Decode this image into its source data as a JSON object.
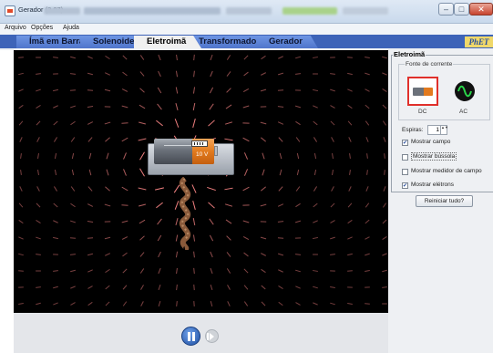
{
  "window": {
    "title": "Gerador (2.07)",
    "minimize": "–",
    "maximize": "□",
    "close": "✕"
  },
  "menu": [
    "Arquivo",
    "Opções",
    "Ajuda"
  ],
  "tabs": [
    {
      "label": "Ímã em Barra",
      "selected": false
    },
    {
      "label": "Solenoide",
      "selected": false
    },
    {
      "label": "Eletroimã",
      "selected": true
    },
    {
      "label": "Transformador",
      "selected": false
    },
    {
      "label": "Gerador",
      "selected": false
    }
  ],
  "logo": "PhET",
  "battery": {
    "voltage_label": "10 V"
  },
  "panel": {
    "title": "Eletroimã",
    "source_group_title": "Fonte de corrente",
    "dc_label": "DC",
    "ac_label": "AC",
    "selected_source": "DC",
    "loops_label": "Espiras:",
    "loops_value": "1",
    "spinner_arrows": "▲▼",
    "checkboxes": [
      {
        "label": "Mostrar campo",
        "checked": true
      },
      {
        "label": "Mostrar bússola",
        "checked": false
      },
      {
        "label": "Mostrar medidor de campo",
        "checked": false
      },
      {
        "label": "Mostrar elétrons",
        "checked": true
      }
    ],
    "reset_label": "Reiniciar tudo?"
  },
  "colors": {
    "tab_bar": "#3d63b8",
    "selected_source_border": "#e0302b",
    "field_arrow": "#ff8888",
    "battery_orange": "#e27a1e",
    "canvas_bg": "#000000"
  },
  "icons": {
    "app": "applet-icon",
    "play": "pause-icon",
    "step": "step-icon",
    "dc": "battery-icon",
    "ac": "ac-sine-icon",
    "check": "✔"
  }
}
